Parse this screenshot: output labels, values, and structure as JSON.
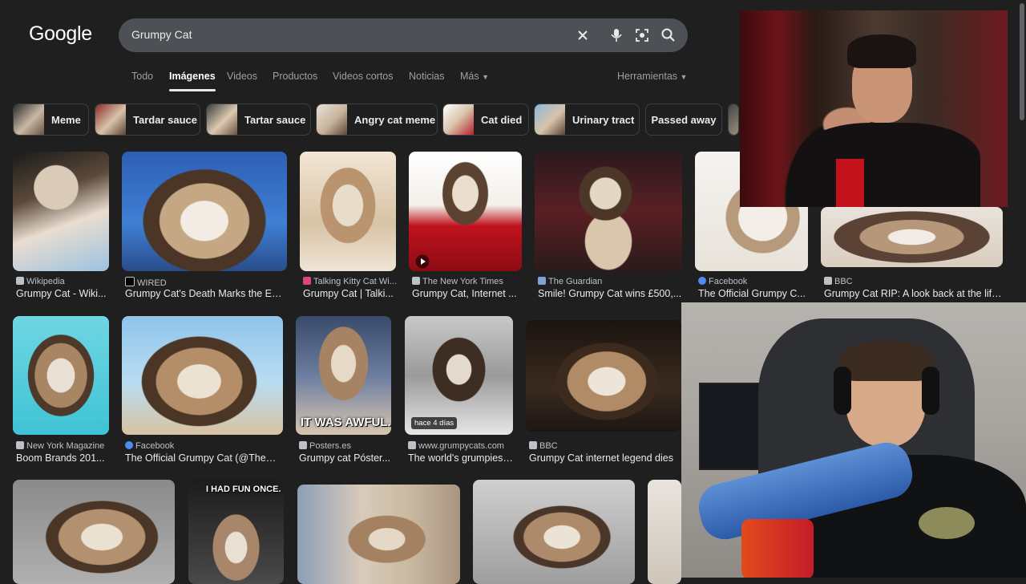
{
  "logo": "Google",
  "search": {
    "query": "Grumpy Cat"
  },
  "tabs": [
    "Todo",
    "Imágenes",
    "Videos",
    "Productos",
    "Videos cortos",
    "Noticias",
    "Más"
  ],
  "tools_label": "Herramientas",
  "chips": [
    "Meme",
    "Tardar sauce",
    "Tartar sauce",
    "Angry cat meme",
    "Cat died",
    "Urinary tract",
    "Passed away"
  ],
  "results": [
    {
      "source": "Wikipedia",
      "title": "Grumpy Cat - Wiki..."
    },
    {
      "source": "WIRED",
      "title": "Grumpy Cat's Death Marks the End..."
    },
    {
      "source": "Talking Kitty Cat Wi...",
      "title": "Grumpy Cat | Talki..."
    },
    {
      "source": "The New York Times",
      "title": "Grumpy Cat, Internet ..."
    },
    {
      "source": "The Guardian",
      "title": "Smile! Grumpy Cat wins £500,..."
    },
    {
      "source": "Facebook",
      "title": "The Official Grumpy C..."
    },
    {
      "source": "BBC",
      "title": "Grumpy Cat RIP: A look back at the life..."
    },
    {
      "source": "New York Magazine",
      "title": "Boom Brands 201..."
    },
    {
      "source": "Facebook",
      "title": "The Official Grumpy Cat (@TheOf..."
    },
    {
      "source": "Posters.es",
      "title": "Grumpy cat Póster..."
    },
    {
      "source": "www.grumpycats.com",
      "title": "The world's grumpiest..."
    },
    {
      "source": "BBC",
      "title": "Grumpy Cat internet legend dies"
    }
  ],
  "overlays": {
    "it_was_awful": "IT WAS AWFUL.",
    "i_had_fun": "I HAD FUN ONCE.",
    "time_badge": "hace 4 días"
  },
  "colors": {
    "background": "#1f1f1f",
    "search_bar": "#4d5156",
    "text": "#e8eaed",
    "muted": "#9aa0a6"
  }
}
